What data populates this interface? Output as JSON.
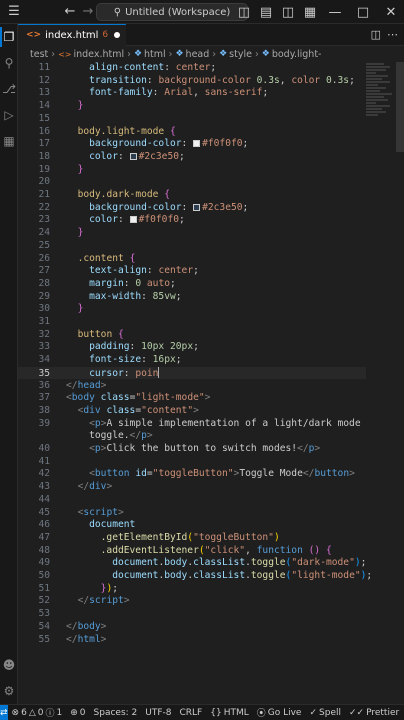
{
  "titlebar": {
    "search_text": "Untitled (Workspace)"
  },
  "tab": {
    "filename": "index.html",
    "problems": "6"
  },
  "breadcrumb": [
    "test",
    "index.html",
    "html",
    "head",
    "style",
    "body.light-"
  ],
  "code": [
    {
      "n": "11",
      "segs": [
        [
          "    ",
          "t-txt"
        ],
        [
          "align-content",
          "t-prop"
        ],
        [
          ": ",
          "t-txt"
        ],
        [
          "center",
          "t-val"
        ],
        [
          ";",
          "t-txt"
        ]
      ]
    },
    {
      "n": "12",
      "segs": [
        [
          "    ",
          "t-txt"
        ],
        [
          "transition",
          "t-prop"
        ],
        [
          ": ",
          "t-txt"
        ],
        [
          "background-color ",
          "t-val"
        ],
        [
          "0.3s",
          "t-num"
        ],
        [
          ", ",
          "t-txt"
        ],
        [
          "color ",
          "t-val"
        ],
        [
          "0.3s",
          "t-num"
        ],
        [
          ";",
          "t-txt"
        ]
      ]
    },
    {
      "n": "13",
      "segs": [
        [
          "    ",
          "t-txt"
        ],
        [
          "font-family",
          "t-prop"
        ],
        [
          ": ",
          "t-txt"
        ],
        [
          "Arial",
          "t-val"
        ],
        [
          ", ",
          "t-txt"
        ],
        [
          "sans-serif",
          "t-val"
        ],
        [
          ";",
          "t-txt"
        ]
      ]
    },
    {
      "n": "14",
      "segs": [
        [
          "  ",
          "t-txt"
        ],
        [
          "}",
          "t-brace2"
        ]
      ]
    },
    {
      "n": "15",
      "segs": []
    },
    {
      "n": "16",
      "segs": [
        [
          "  ",
          "t-txt"
        ],
        [
          "body.light-mode",
          "t-sel"
        ],
        [
          " ",
          "t-txt"
        ],
        [
          "{",
          "t-brace2"
        ]
      ]
    },
    {
      "n": "17",
      "segs": [
        [
          "    ",
          "t-txt"
        ],
        [
          "background-color",
          "t-prop"
        ],
        [
          ": ",
          "t-txt"
        ],
        [
          "SW:#f0f0f0",
          "sw"
        ],
        [
          "#f0f0f0",
          "t-val"
        ],
        [
          ";",
          "t-txt"
        ]
      ]
    },
    {
      "n": "18",
      "segs": [
        [
          "    ",
          "t-txt"
        ],
        [
          "color",
          "t-prop"
        ],
        [
          ": ",
          "t-txt"
        ],
        [
          "SW:#2c3e50",
          "sw"
        ],
        [
          "#2c3e50",
          "t-val"
        ],
        [
          ";",
          "t-txt"
        ]
      ]
    },
    {
      "n": "19",
      "segs": [
        [
          "  ",
          "t-txt"
        ],
        [
          "}",
          "t-brace2"
        ]
      ]
    },
    {
      "n": "20",
      "segs": []
    },
    {
      "n": "21",
      "segs": [
        [
          "  ",
          "t-txt"
        ],
        [
          "body.dark-mode",
          "t-sel"
        ],
        [
          " ",
          "t-txt"
        ],
        [
          "{",
          "t-brace2"
        ]
      ]
    },
    {
      "n": "22",
      "segs": [
        [
          "    ",
          "t-txt"
        ],
        [
          "background-color",
          "t-prop"
        ],
        [
          ": ",
          "t-txt"
        ],
        [
          "SW:#2c3e50",
          "sw"
        ],
        [
          "#2c3e50",
          "t-val"
        ],
        [
          ";",
          "t-txt"
        ]
      ]
    },
    {
      "n": "23",
      "segs": [
        [
          "    ",
          "t-txt"
        ],
        [
          "color",
          "t-prop"
        ],
        [
          ": ",
          "t-txt"
        ],
        [
          "SW:#f0f0f0",
          "sw"
        ],
        [
          "#f0f0f0",
          "t-val"
        ],
        [
          ";",
          "t-txt"
        ]
      ]
    },
    {
      "n": "24",
      "segs": [
        [
          "  ",
          "t-txt"
        ],
        [
          "}",
          "t-brace2"
        ]
      ]
    },
    {
      "n": "25",
      "segs": []
    },
    {
      "n": "26",
      "segs": [
        [
          "  ",
          "t-txt"
        ],
        [
          ".content",
          "t-sel"
        ],
        [
          " ",
          "t-txt"
        ],
        [
          "{",
          "t-brace2"
        ]
      ]
    },
    {
      "n": "27",
      "segs": [
        [
          "    ",
          "t-txt"
        ],
        [
          "text-align",
          "t-prop"
        ],
        [
          ": ",
          "t-txt"
        ],
        [
          "center",
          "t-val"
        ],
        [
          ";",
          "t-txt"
        ]
      ]
    },
    {
      "n": "28",
      "segs": [
        [
          "    ",
          "t-txt"
        ],
        [
          "margin",
          "t-prop"
        ],
        [
          ": ",
          "t-txt"
        ],
        [
          "0",
          "t-num"
        ],
        [
          " ",
          "t-txt"
        ],
        [
          "auto",
          "t-val"
        ],
        [
          ";",
          "t-txt"
        ]
      ]
    },
    {
      "n": "29",
      "segs": [
        [
          "    ",
          "t-txt"
        ],
        [
          "max-width",
          "t-prop"
        ],
        [
          ": ",
          "t-txt"
        ],
        [
          "85vw",
          "t-num"
        ],
        [
          ";",
          "t-txt"
        ]
      ]
    },
    {
      "n": "30",
      "segs": [
        [
          "  ",
          "t-txt"
        ],
        [
          "}",
          "t-brace2"
        ]
      ]
    },
    {
      "n": "31",
      "segs": []
    },
    {
      "n": "32",
      "segs": [
        [
          "  ",
          "t-txt"
        ],
        [
          "button",
          "t-sel"
        ],
        [
          " ",
          "t-txt"
        ],
        [
          "{",
          "t-brace2"
        ]
      ]
    },
    {
      "n": "33",
      "segs": [
        [
          "    ",
          "t-txt"
        ],
        [
          "padding",
          "t-prop"
        ],
        [
          ": ",
          "t-txt"
        ],
        [
          "10px",
          "t-num"
        ],
        [
          " ",
          "t-txt"
        ],
        [
          "20px",
          "t-num"
        ],
        [
          ";",
          "t-txt"
        ]
      ]
    },
    {
      "n": "34",
      "segs": [
        [
          "    ",
          "t-txt"
        ],
        [
          "font-size",
          "t-prop"
        ],
        [
          ": ",
          "t-txt"
        ],
        [
          "16px",
          "t-num"
        ],
        [
          ";",
          "t-txt"
        ]
      ]
    },
    {
      "n": "35",
      "segs": [
        [
          "    ",
          "t-txt"
        ],
        [
          "cursor",
          "t-prop"
        ],
        [
          ": ",
          "t-txt"
        ],
        [
          "poin",
          "t-val"
        ],
        [
          "CURSOR",
          "cursor"
        ]
      ],
      "current": true
    },
    {
      "n": "36",
      "segs": [
        [
          "</",
          "t-br"
        ],
        [
          "head",
          "t-tag"
        ],
        [
          ">",
          "t-br"
        ]
      ]
    },
    {
      "n": "37",
      "segs": [
        [
          "<",
          "t-br"
        ],
        [
          "body",
          "t-tag"
        ],
        [
          " ",
          "t-txt"
        ],
        [
          "class",
          "t-attr"
        ],
        [
          "=",
          "t-txt"
        ],
        [
          "\"light-mode\"",
          "t-str"
        ],
        [
          ">",
          "t-br"
        ]
      ]
    },
    {
      "n": "38",
      "segs": [
        [
          "  ",
          "t-txt"
        ],
        [
          "<",
          "t-br"
        ],
        [
          "div",
          "t-tag"
        ],
        [
          " ",
          "t-txt"
        ],
        [
          "class",
          "t-attr"
        ],
        [
          "=",
          "t-txt"
        ],
        [
          "\"content\"",
          "t-str"
        ],
        [
          ">",
          "t-br"
        ]
      ]
    },
    {
      "n": "39",
      "segs": [
        [
          "    ",
          "t-txt"
        ],
        [
          "<",
          "t-br"
        ],
        [
          "p",
          "t-tag"
        ],
        [
          ">",
          "t-br"
        ],
        [
          "A simple implementation of a light/dark mode",
          "t-txt"
        ]
      ]
    },
    {
      "n": "",
      "segs": [
        [
          "    ",
          "t-txt"
        ],
        [
          "toggle.",
          "t-txt"
        ],
        [
          "</",
          "t-br"
        ],
        [
          "p",
          "t-tag"
        ],
        [
          ">",
          "t-br"
        ]
      ]
    },
    {
      "n": "40",
      "segs": [
        [
          "    ",
          "t-txt"
        ],
        [
          "<",
          "t-br"
        ],
        [
          "p",
          "t-tag"
        ],
        [
          ">",
          "t-br"
        ],
        [
          "Click the button to switch modes!",
          "t-txt"
        ],
        [
          "</",
          "t-br"
        ],
        [
          "p",
          "t-tag"
        ],
        [
          ">",
          "t-br"
        ]
      ]
    },
    {
      "n": "41",
      "segs": []
    },
    {
      "n": "42",
      "segs": [
        [
          "    ",
          "t-txt"
        ],
        [
          "<",
          "t-br"
        ],
        [
          "button",
          "t-tag"
        ],
        [
          " ",
          "t-txt"
        ],
        [
          "id",
          "t-attr"
        ],
        [
          "=",
          "t-txt"
        ],
        [
          "\"toggleButton\"",
          "t-str"
        ],
        [
          ">",
          "t-br"
        ],
        [
          "Toggle Mode",
          "t-txt"
        ],
        [
          "</",
          "t-br"
        ],
        [
          "button",
          "t-tag"
        ],
        [
          ">",
          "t-br"
        ]
      ]
    },
    {
      "n": "43",
      "segs": [
        [
          "  ",
          "t-txt"
        ],
        [
          "</",
          "t-br"
        ],
        [
          "div",
          "t-tag"
        ],
        [
          ">",
          "t-br"
        ]
      ]
    },
    {
      "n": "44",
      "segs": []
    },
    {
      "n": "45",
      "segs": [
        [
          "  ",
          "t-txt"
        ],
        [
          "<",
          "t-br"
        ],
        [
          "script",
          "t-tag"
        ],
        [
          ">",
          "t-br"
        ]
      ]
    },
    {
      "n": "46",
      "segs": [
        [
          "    ",
          "t-txt"
        ],
        [
          "document",
          "t-var"
        ]
      ]
    },
    {
      "n": "47",
      "segs": [
        [
          "      ",
          "t-txt"
        ],
        [
          ".getElementById",
          "t-fn"
        ],
        [
          "(",
          "t-brace"
        ],
        [
          "\"toggleButton\"",
          "t-str"
        ],
        [
          ")",
          "t-brace"
        ]
      ]
    },
    {
      "n": "48",
      "segs": [
        [
          "      ",
          "t-txt"
        ],
        [
          ".addEventListener",
          "t-fn"
        ],
        [
          "(",
          "t-brace"
        ],
        [
          "\"click\"",
          "t-str"
        ],
        [
          ", ",
          "t-txt"
        ],
        [
          "function",
          "t-kw"
        ],
        [
          " ",
          "t-txt"
        ],
        [
          "()",
          "t-brace2"
        ],
        [
          " ",
          "t-txt"
        ],
        [
          "{",
          "t-brace2"
        ]
      ]
    },
    {
      "n": "49",
      "segs": [
        [
          "        ",
          "t-txt"
        ],
        [
          "document",
          "t-var"
        ],
        [
          ".",
          "t-txt"
        ],
        [
          "body",
          "t-var"
        ],
        [
          ".",
          "t-txt"
        ],
        [
          "classList",
          "t-var"
        ],
        [
          ".",
          "t-txt"
        ],
        [
          "toggle",
          "t-fn"
        ],
        [
          "(",
          "t-brace3"
        ],
        [
          "\"dark-mode\"",
          "t-str"
        ],
        [
          ")",
          "t-brace3"
        ],
        [
          ";",
          "t-txt"
        ]
      ]
    },
    {
      "n": "50",
      "segs": [
        [
          "        ",
          "t-txt"
        ],
        [
          "document",
          "t-var"
        ],
        [
          ".",
          "t-txt"
        ],
        [
          "body",
          "t-var"
        ],
        [
          ".",
          "t-txt"
        ],
        [
          "classList",
          "t-var"
        ],
        [
          ".",
          "t-txt"
        ],
        [
          "toggle",
          "t-fn"
        ],
        [
          "(",
          "t-brace3"
        ],
        [
          "\"light-mode\"",
          "t-str"
        ],
        [
          ")",
          "t-brace3"
        ],
        [
          ";",
          "t-txt"
        ]
      ]
    },
    {
      "n": "51",
      "segs": [
        [
          "      ",
          "t-txt"
        ],
        [
          "}",
          "t-brace2"
        ],
        [
          ")",
          "t-brace"
        ],
        [
          ";",
          "t-txt"
        ]
      ]
    },
    {
      "n": "52",
      "segs": [
        [
          "  ",
          "t-txt"
        ],
        [
          "</",
          "t-br"
        ],
        [
          "script",
          "t-tag"
        ],
        [
          ">",
          "t-br"
        ]
      ]
    },
    {
      "n": "53",
      "segs": []
    },
    {
      "n": "54",
      "segs": [
        [
          "</",
          "t-br"
        ],
        [
          "body",
          "t-tag"
        ],
        [
          ">",
          "t-br"
        ]
      ]
    },
    {
      "n": "55",
      "segs": [
        [
          "</",
          "t-br"
        ],
        [
          "html",
          "t-tag"
        ],
        [
          ">",
          "t-br"
        ]
      ]
    }
  ],
  "status": {
    "errors": "6",
    "warnings": "0",
    "info": "1",
    "ports": "0",
    "spaces": "Spaces: 2",
    "encoding": "UTF-8",
    "eol": "CRLF",
    "language": "HTML",
    "golive": "Go Live",
    "spell": "Spell",
    "prettier": "Prettier"
  },
  "colors": {
    "accent": "#0078d4"
  }
}
